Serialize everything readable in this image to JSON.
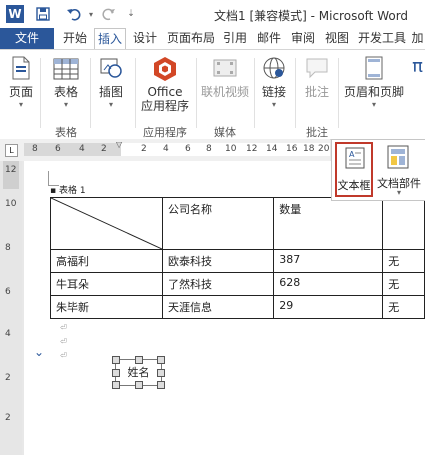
{
  "quick_access": {
    "word_icon": "word-app-icon",
    "save_icon": "save-icon",
    "undo_icon": "undo-icon",
    "redo_icon": "redo-icon"
  },
  "window_title": "文档1 [兼容模式] - Microsoft Word",
  "tabs": [
    "文件",
    "开始",
    "插入",
    "设计",
    "页面布局",
    "引用",
    "邮件",
    "审阅",
    "视图",
    "开发工具",
    "加"
  ],
  "ribbon": {
    "buttons": {
      "pages": "页面",
      "table": "表格",
      "illustrations": "插图",
      "office_apps_line1": "Office",
      "office_apps_line2": "应用程序",
      "online_video": "联机视频",
      "links": "链接",
      "comment": "批注",
      "header_footer": "页眉和页脚"
    },
    "groups": {
      "table": "表格",
      "apps": "应用程序",
      "media": "媒体",
      "comments": "批注"
    }
  },
  "ruler": {
    "numbers": [
      "8",
      "6",
      "4",
      "2",
      "2",
      "4",
      "6",
      "8",
      "10",
      "12",
      "14",
      "16",
      "18",
      "20"
    ],
    "vertical_numbers": [
      "12",
      "10",
      "8",
      "6",
      "4",
      "2",
      "2"
    ]
  },
  "dropdown": {
    "text_box": "文本框",
    "doc_parts": "文档部件"
  },
  "document": {
    "caption": "表格 1",
    "table": {
      "header": [
        "",
        "公司名称",
        "数量",
        ""
      ],
      "rows": [
        [
          "高福利",
          "欧泰科技",
          "387",
          "无"
        ],
        [
          "牛耳朵",
          "了然科技",
          "628",
          "无"
        ],
        [
          "朱毕新",
          "天涯信息",
          "29",
          "无"
        ]
      ]
    },
    "shape_text": "姓名"
  },
  "colors": {
    "accent": "#2b579a",
    "highlight": "#c0392b",
    "office_icon": "#d24726"
  }
}
